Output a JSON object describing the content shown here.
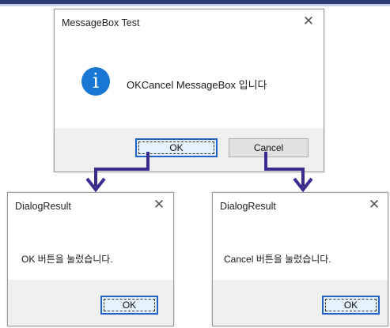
{
  "main_dialog": {
    "title": "MessageBox Test",
    "close_glyph": "✕",
    "icon": "info-icon",
    "icon_glyph": "i",
    "message": "OKCancel MessageBox 입니다",
    "ok_label": "OK",
    "cancel_label": "Cancel"
  },
  "result_ok": {
    "title": "DialogResult",
    "close_glyph": "✕",
    "message": "OK 버튼을 눌렀습니다.",
    "ok_label": "OK"
  },
  "result_cancel": {
    "title": "DialogResult",
    "close_glyph": "✕",
    "message": "Cancel 버튼을 눌렀습니다.",
    "ok_label": "OK"
  },
  "colors": {
    "accent": "#1f63c6",
    "arrow": "#3a2c8f",
    "info_icon": "#1877d4",
    "footer_bg": "#efefef"
  }
}
